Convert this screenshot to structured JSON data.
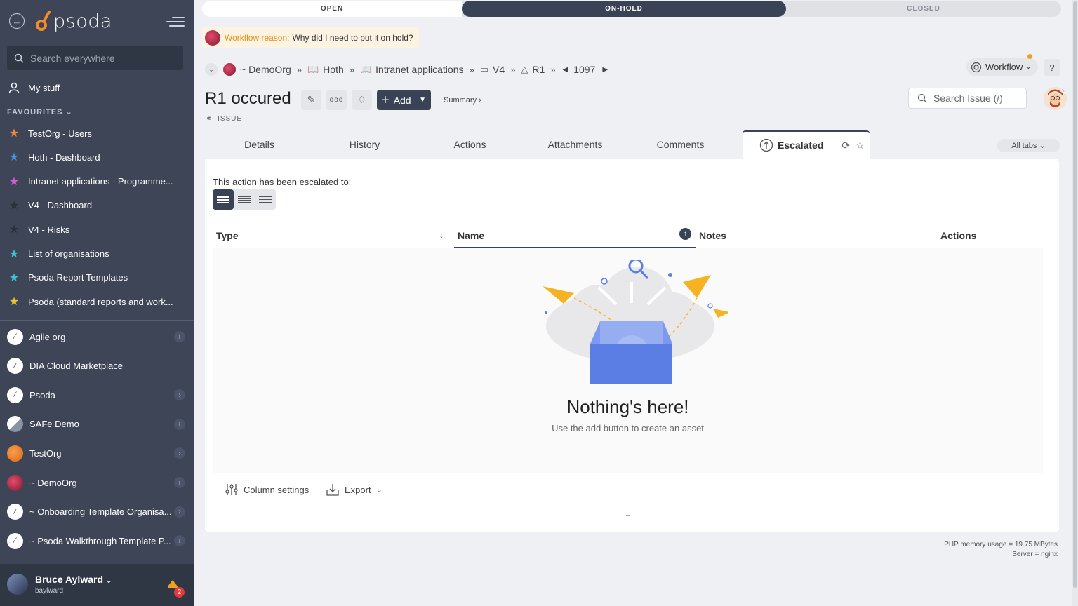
{
  "sidebar": {
    "logo_text": "psoda",
    "search_placeholder": "Search everywhere",
    "my_stuff": "My stuff",
    "favourites_title": "FAVOURITES",
    "favourites": [
      {
        "label": "TestOrg - Users",
        "color": "#f08a3c"
      },
      {
        "label": "Hoth - Dashboard",
        "color": "#4a90e2"
      },
      {
        "label": "Intranet applications - Programme...",
        "color": "#d65bd0"
      },
      {
        "label": "V4 - Dashboard",
        "color": "#2a2f3a"
      },
      {
        "label": "V4 - Risks",
        "color": "#2a2f3a"
      },
      {
        "label": "List of organisations",
        "color": "#3fc1d9"
      },
      {
        "label": "Psoda Report Templates",
        "color": "#3fc1d9"
      },
      {
        "label": "Psoda (standard reports and work...",
        "color": "#f2c230"
      }
    ],
    "orgs": [
      {
        "label": "Agile org",
        "has_children": true
      },
      {
        "label": "DIA Cloud Marketplace",
        "has_children": false
      },
      {
        "label": "Psoda",
        "has_children": true
      },
      {
        "label": "SAFe Demo",
        "has_children": true
      },
      {
        "label": "TestOrg",
        "has_children": true
      },
      {
        "label": "~ DemoOrg",
        "has_children": true
      },
      {
        "label": "~ Onboarding Template Organisa...",
        "has_children": true
      },
      {
        "label": "~ Psoda Walkthrough Template P...",
        "has_children": true
      }
    ],
    "user": {
      "name": "Bruce Aylward",
      "username": "baylward",
      "notifications": "2"
    }
  },
  "status": {
    "open": "OPEN",
    "on_hold": "ON-HOLD",
    "closed": "CLOSED",
    "current": "ON-HOLD"
  },
  "workflow_reason": {
    "label": "Workflow reason:",
    "text": "Why did I need to put it on hold?"
  },
  "breadcrumbs": [
    "~ DemoOrg",
    "Hoth",
    "Intranet applications",
    "V4",
    "R1"
  ],
  "record_number": "1097",
  "workflow_button": "Workflow",
  "help_button": "?",
  "page": {
    "title": "R1 occured",
    "type": "ISSUE",
    "add_label": "Add",
    "summary_link": "Summary ›"
  },
  "search_issue_placeholder": "Search Issue (/)",
  "tabs": [
    "Details",
    "History",
    "Actions",
    "Attachments",
    "Comments",
    "Escalated"
  ],
  "active_tab": "Escalated",
  "all_tabs": "All tabs",
  "panel": {
    "escalated_text": "This action has been escalated to:",
    "columns": [
      "Type",
      "Name",
      "Notes",
      "Actions"
    ],
    "empty_title": "Nothing's here!",
    "empty_sub": "Use the add button to create an asset",
    "column_settings": "Column settings",
    "export": "Export"
  },
  "footer": {
    "memory": "PHP memory usage = 19.75 MBytes",
    "server": "Server = nginx"
  },
  "colors": {
    "sidebar": "#3d4557",
    "accent_dark": "#3a4356",
    "orange": "#f0a020"
  }
}
